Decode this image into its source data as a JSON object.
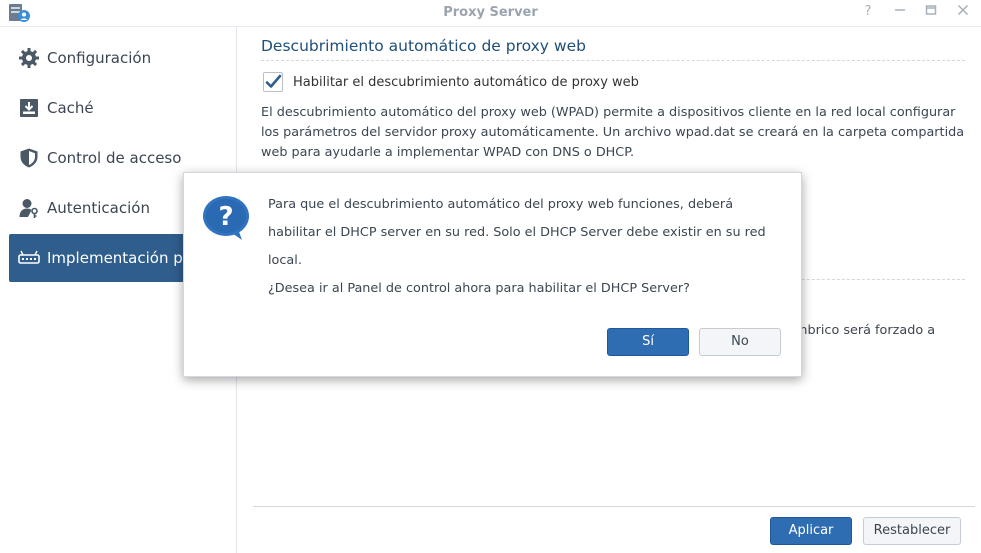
{
  "window": {
    "title": "Proxy Server"
  },
  "sidebar": {
    "items": [
      {
        "label": "Configuración",
        "icon": "gear-icon"
      },
      {
        "label": "Caché",
        "icon": "download-box-icon"
      },
      {
        "label": "Control de acceso",
        "icon": "shield-icon"
      },
      {
        "label": "Autenticación",
        "icon": "user-key-icon"
      },
      {
        "label": "Implementación proxy",
        "icon": "router-icon",
        "active": true
      }
    ]
  },
  "main": {
    "section_title": "Descubrimiento automático de proxy web",
    "checkbox_label": "Habilitar el descubrimiento automático de proxy web",
    "checkbox_checked": true,
    "description": "El descubrimiento automático del proxy web (WPAD) permite a dispositivos cliente en la red local configurar los parámetros del servidor proxy automáticamente. Un archivo wpad.dat se creará en la carpeta compartida web para ayudarle a implementar WPAD con DNS o DHCP.",
    "partial_text": "mbrico será forzado a",
    "apply_label": "Aplicar",
    "reset_label": "Restablecer"
  },
  "dialog": {
    "message": "Para que el descubrimiento automático del proxy web funciones, deberá habilitar el DHCP server en su red. Solo el DHCP Server debe existir en su red local.",
    "question": "¿Desea ir al Panel de control ahora para habilitar el DHCP Server?",
    "yes_label": "Sí",
    "no_label": "No"
  },
  "colors": {
    "accent": "#2f6db3",
    "sidebar_active": "#2f5d8c",
    "section_title": "#1f4e79"
  }
}
